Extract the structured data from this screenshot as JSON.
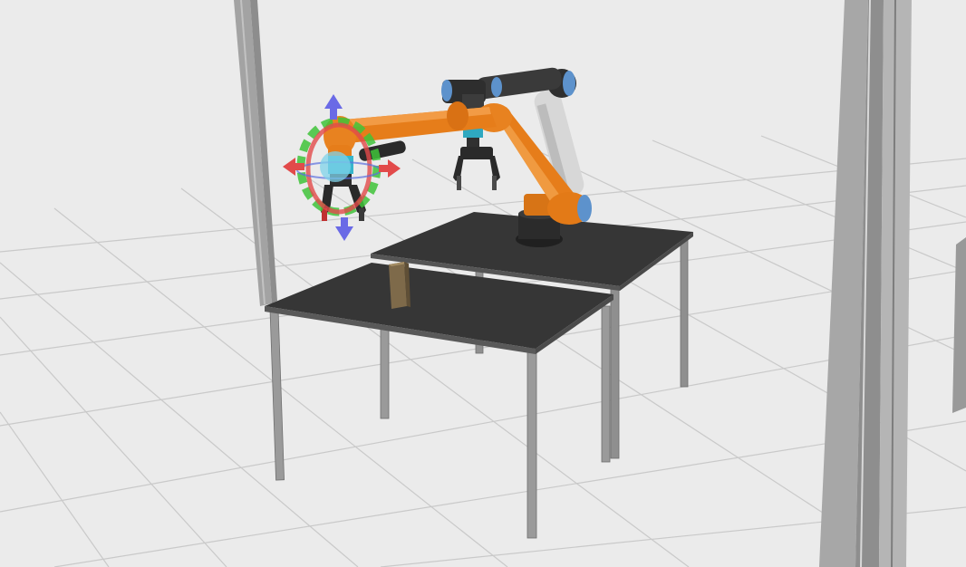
{
  "scene": {
    "background_color": "#ebebeb",
    "grid_color": "#c7c7c7",
    "table_top_color": "#373737",
    "table_leg_color": "#9a9a9a",
    "pillar_color": "#a9a9a9",
    "robot_orange": "#e8801c",
    "robot_dark_orange": "#b55f0e",
    "robot_joint_cap": "#5b8fc7",
    "robot_grey_link": "#d0d0d0",
    "gripper_teal": "#3bb3c9",
    "block_color": "#8a7350"
  },
  "interactive_marker": {
    "ring_x_color": "#e24a4a",
    "ring_y_color": "#3fc33a",
    "arrow_z_color": "#6a6ae6",
    "arrow_x_color": "#e24a4a",
    "sphere_color": "#7fd3ea"
  }
}
